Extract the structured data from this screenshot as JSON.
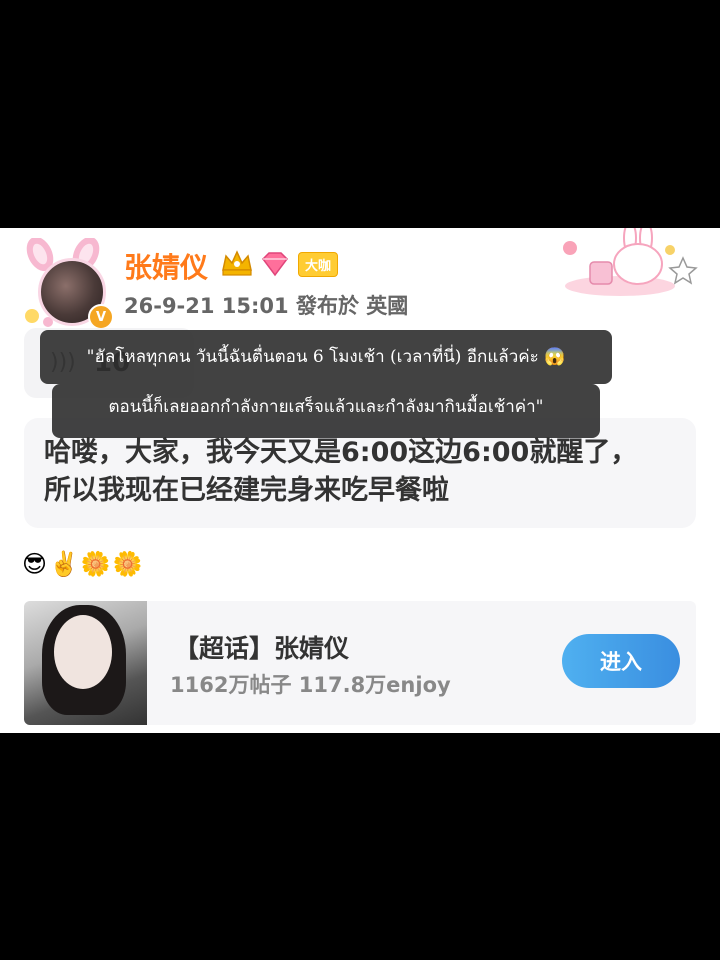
{
  "post": {
    "username": "张婧仪",
    "badge_label": "大咖",
    "meta": "26-9-21 15:01  發布於 英國",
    "audio_num": "10",
    "text_line1": "哈喽，大家，我今天又是6:00这边6:00就醒了，",
    "text_line2": "所以我现在已经建完身来吃早餐啦",
    "emojis": "😎✌️🌼🌼"
  },
  "topic": {
    "title": "【超话】张婧仪",
    "stats": "1162万帖子 117.8万enjoy",
    "enter_label": "进入"
  },
  "captions": {
    "line1": "\"ฮัลโหลทุกคน วันนี้ฉันตื่นตอน 6 โมงเช้า (เวลาที่นี่) อีกแล้วค่ะ 😱",
    "line2": "ตอนนี้ก็เลยออกกำลังกายเสร็จแล้วและกำลังมากินมื้อเช้าค่า\""
  },
  "colors": {
    "username": "#ff7a1a",
    "enter_button": "#3a8ee0",
    "badge": "#ffcc33"
  }
}
